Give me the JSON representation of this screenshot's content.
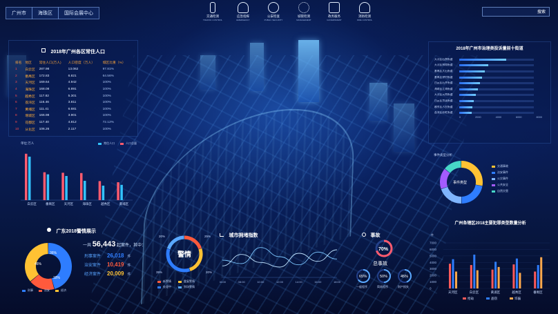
{
  "topbar": {
    "breadcrumbs": [
      "广州市",
      "海珠区",
      "国际会展中心"
    ],
    "nav": [
      {
        "label": "交通检测",
        "sub": "TRAFFIC CONTROL",
        "icon": "traffic-light-icon"
      },
      {
        "label": "应急指挥",
        "sub": "EMERGENCY",
        "icon": "police-officer-icon"
      },
      {
        "label": "公安检查",
        "sub": "PUBLIC SECURITY",
        "icon": "police-badge-icon"
      },
      {
        "label": "城管检测",
        "sub": "MANAGEMENT",
        "icon": "network-nodes-icon"
      },
      {
        "label": "政务服务",
        "sub": "GOVERNMENT",
        "icon": "government-building-icon"
      },
      {
        "label": "消防检测",
        "sub": "FIRE CONTROL",
        "icon": "firefighter-icon"
      }
    ],
    "search": {
      "placeholder": "",
      "button": "搜索"
    }
  },
  "population": {
    "title": "2018年广州各区常住人口",
    "columns": [
      "排名",
      "地区",
      "常住人口(万人)",
      "人口密度（万人）",
      "城区比重（%）"
    ],
    "rows": [
      {
        "rank": "1",
        "district": "白云区",
        "population": "287.98",
        "density": "13.062",
        "ratio": "97.81%"
      },
      {
        "rank": "2",
        "district": "番禺区",
        "population": "172.83",
        "density": "6.821",
        "ratio": "64.56%"
      },
      {
        "rank": "3",
        "district": "天河区",
        "population": "169.64",
        "density": "4.942",
        "ratio": "100%"
      },
      {
        "rank": "4",
        "district": "海珠区",
        "population": "168.08",
        "density": "6.891",
        "ratio": "100%"
      },
      {
        "rank": "5",
        "district": "越秀区",
        "population": "117.82",
        "density": "5.301",
        "ratio": "100%"
      },
      {
        "rank": "6",
        "district": "荔湾区",
        "population": "116.46",
        "density": "3.811",
        "ratio": "100%"
      },
      {
        "rank": "7",
        "district": "黄埔区",
        "population": "111.41",
        "density": "6.681",
        "ratio": "100%"
      },
      {
        "rank": "8",
        "district": "增城区",
        "population": "166.98",
        "density": "3.901",
        "ratio": "100%"
      },
      {
        "rank": "9",
        "district": "花都区",
        "population": "117.40",
        "density": "4.812",
        "ratio": "72.12%"
      },
      {
        "rank": "10",
        "district": "从化区",
        "population": "106.26",
        "density": "2.117",
        "ratio": "100%"
      }
    ]
  },
  "pop_chart": {
    "unit": "单位:万人",
    "legend": [
      "常住人口",
      "人口总量"
    ],
    "colors": [
      "#ff5b6e",
      "#33c3ff"
    ],
    "chart_data": {
      "type": "bar",
      "categories": [
        "白云区",
        "番禺区",
        "天河区",
        "海珠区",
        "越秀区",
        "黄埔区"
      ],
      "series": [
        {
          "name": "常住人口",
          "values": [
            288,
            173,
            170,
            168,
            118,
            111
          ]
        },
        {
          "name": "人口总量",
          "values": [
            270,
            160,
            150,
            120,
            90,
            95
          ]
        }
      ],
      "ylim": [
        0,
        300
      ]
    }
  },
  "alerts": {
    "title": "广东2018警情展示",
    "summary_prefix": "一共",
    "total": "56,443",
    "summary_suffix": "起案件，其中：",
    "cases": [
      {
        "label": "刑事案件",
        "value": "26,018",
        "unit": "件",
        "color": "#2e7dff"
      },
      {
        "label": "治安案件",
        "value": "10,419",
        "unit": "件",
        "color": "#ff5a3c"
      },
      {
        "label": "经济案件",
        "value": "20,009",
        "unit": "件",
        "color": "#ffc233"
      }
    ],
    "donut_labels": [
      "46%",
      "18%",
      "36%"
    ],
    "legend": [
      "刑事",
      "治安",
      "经济"
    ],
    "chart_data": {
      "type": "pie",
      "categories": [
        "刑事",
        "治安",
        "经济"
      ],
      "values": [
        46,
        18,
        36
      ]
    }
  },
  "warning": {
    "center": "警情",
    "percent_labels": [
      "20%",
      "25%",
      "35%",
      "20%"
    ],
    "legend": [
      {
        "label": "新警情",
        "color": "#ff5a3c"
      },
      {
        "label": "重复警情",
        "color": "#ffc233"
      },
      {
        "label": "处理中",
        "color": "#2e7dff"
      },
      {
        "label": "到场警情",
        "color": "#59a8ff"
      }
    ],
    "chart_data": {
      "type": "pie",
      "categories": [
        "新警情",
        "重复警情",
        "处理中",
        "到场警情"
      ],
      "values": [
        20,
        25,
        35,
        20
      ]
    }
  },
  "congestion": {
    "title": "城市拥堵指数",
    "xticks": [
      "06:00",
      "08:00",
      "10:00",
      "12:00",
      "14:00",
      "16:00",
      "18:00"
    ],
    "chart_data": {
      "type": "line",
      "x": [
        "06:00",
        "08:00",
        "10:00",
        "12:00",
        "14:00",
        "16:00",
        "18:00"
      ],
      "series": [
        {
          "values": [
            1.5,
            1.2,
            2.6,
            1.8,
            1.1,
            2.2,
            1.6
          ]
        },
        {
          "values": [
            1.0,
            2.0,
            1.3,
            0.9,
            2.1,
            1.4,
            2.4
          ]
        }
      ]
    }
  },
  "accident": {
    "title": "事故",
    "center_value": "70%",
    "center_label": "总事故",
    "items": [
      {
        "value": "65%",
        "label": "一般程序"
      },
      {
        "value": "50%",
        "label": "简易程序"
      },
      {
        "value": "45%",
        "label": "财产损失"
      }
    ]
  },
  "complaints": {
    "title": "2018年广州市治理类投诉量前十街道",
    "streets": [
      "天河区石牌街道",
      "天河区林和街道",
      "番禺区大石街道",
      "番禺区钟村街道",
      "白云区石井街道",
      "海珠区江海街道",
      "天河区元岗街道",
      "白云区京溪街道",
      "越秀区人民街道",
      "荔湾区彩虹街道"
    ],
    "values": [
      5020,
      3120,
      2710,
      2410,
      2210,
      1980,
      1760,
      1520,
      1400,
      1320
    ],
    "ticks": [
      "0",
      "2000",
      "4000",
      "6000",
      "8000"
    ],
    "chart_data": {
      "type": "bar",
      "categories": [
        "天河区石牌街道",
        "天河区林和街道",
        "番禺区大石街道",
        "番禺区钟村街道",
        "白云区石井街道",
        "海珠区江海街道",
        "天河区元岗街道",
        "白云区京溪街道",
        "越秀区人民街道",
        "荔湾区彩虹街道"
      ],
      "values": [
        5020,
        3120,
        2710,
        2410,
        2210,
        1980,
        1760,
        1520,
        1400,
        1320
      ],
      "xlim": [
        0,
        8000
      ]
    }
  },
  "types": {
    "title": "事件类型分析",
    "center": "事件类型",
    "legend": [
      "交通事故",
      "治安事件",
      "火灾事件",
      "公共安全",
      "自然灾害"
    ],
    "colors": [
      "#ffc233",
      "#2e7dff",
      "#7fb5ff",
      "#a45bff",
      "#47d7c7"
    ],
    "chart_data": {
      "type": "pie",
      "categories": [
        "交通事故",
        "治安事件",
        "火灾事件",
        "公共安全",
        "自然灾害"
      ],
      "values": [
        28,
        22,
        20,
        16,
        14
      ]
    }
  },
  "crime": {
    "title": "广州各辖区2018主要犯罪类型数量分析",
    "yunit": "件",
    "yticks": [
      "7000",
      "6000",
      "5000",
      "4000",
      "3000",
      "2000",
      "1000",
      "0"
    ],
    "legend": [
      "抢劫",
      "盗窃",
      "诈骗"
    ],
    "colors": [
      "#ff5a5a",
      "#2e7dff",
      "#ffa94d"
    ],
    "chart_data": {
      "type": "bar",
      "categories": [
        "天河区",
        "白云区",
        "黄浦区",
        "越秀区",
        "番禺区"
      ],
      "series": [
        {
          "name": "抢劫",
          "values": [
            3800,
            3600,
            2900,
            3700,
            2600
          ]
        },
        {
          "name": "盗窃",
          "values": [
            4500,
            5200,
            4100,
            4600,
            3600
          ]
        },
        {
          "name": "诈骗",
          "values": [
            2600,
            2800,
            3300,
            2400,
            4800
          ]
        }
      ],
      "ylim": [
        0,
        7000
      ]
    }
  }
}
